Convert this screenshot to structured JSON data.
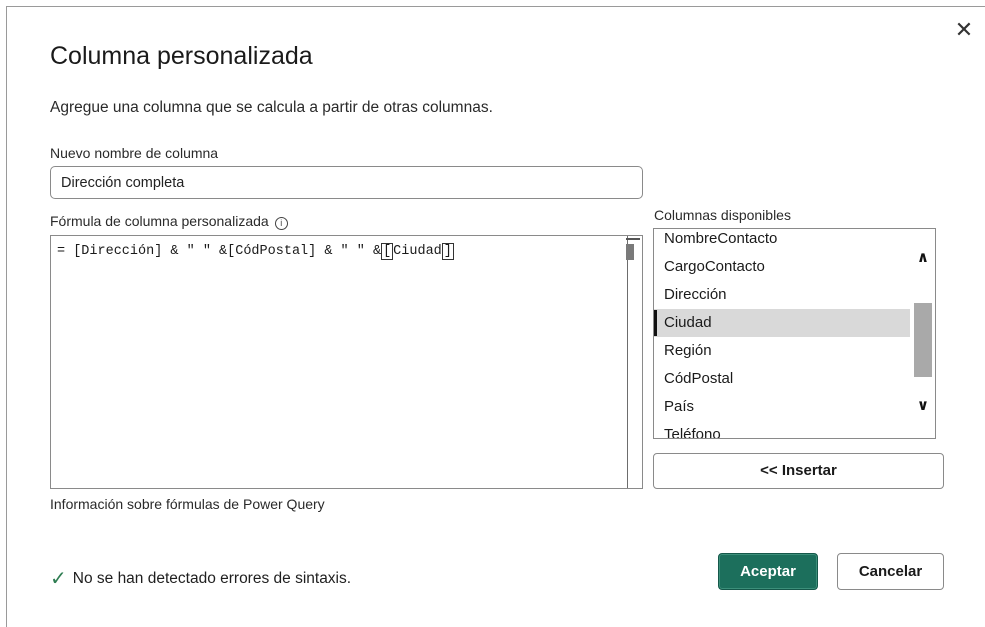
{
  "dialog": {
    "title": "Columna personalizada",
    "subtitle": "Agregue una columna que se calcula a partir de otras columnas.",
    "close_icon": "close-icon"
  },
  "name_field": {
    "label": "Nuevo nombre de columna",
    "value": "Dirección completa"
  },
  "formula": {
    "label": "Fórmula de columna personalizada",
    "info_icon": "info-icon",
    "prefix": "= [Dirección] & \" \" &[CódPostal] & \" \" &",
    "open_bracket": "[",
    "field": "Ciudad",
    "close_bracket": "]"
  },
  "columns": {
    "label": "Columnas disponibles",
    "items": [
      {
        "label": "NombreContacto",
        "selected": false
      },
      {
        "label": "CargoContacto",
        "selected": false
      },
      {
        "label": "Dirección",
        "selected": false
      },
      {
        "label": "Ciudad",
        "selected": true
      },
      {
        "label": "Región",
        "selected": false
      },
      {
        "label": "CódPostal",
        "selected": false
      },
      {
        "label": "País",
        "selected": false
      },
      {
        "label": "Teléfono",
        "selected": false
      }
    ],
    "insert_label": "<< Insertar"
  },
  "help_link": "Información sobre fórmulas de Power Query",
  "status": {
    "icon": "checkmark-icon",
    "color": "#2e7d52",
    "text": "No se han detectado errores de sintaxis."
  },
  "buttons": {
    "ok_label": "Aceptar",
    "cancel_label": "Cancelar",
    "ok_color": "#1c6f5c"
  }
}
